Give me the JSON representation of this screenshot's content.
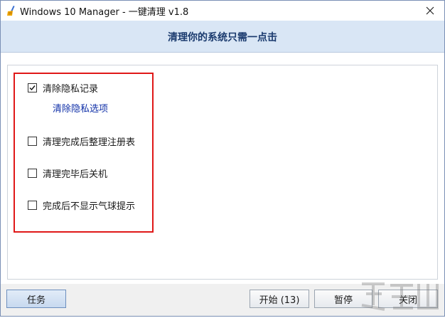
{
  "window": {
    "title": "Windows 10 Manager - 一键清理 v1.8"
  },
  "header": {
    "title": "清理你的系统只需一点击"
  },
  "options": [
    {
      "label": "清除隐私记录",
      "checked": true
    },
    {
      "label": "清理完成后整理注册表",
      "checked": false
    },
    {
      "label": "清理完毕后关机",
      "checked": false
    },
    {
      "label": "完成后不显示气球提示",
      "checked": false
    }
  ],
  "privacy_link": "清除隐私选项",
  "buttons": {
    "tasks": "任务",
    "start": "开始 (13)",
    "pause": "暂停",
    "close": "关闭"
  },
  "colors": {
    "highlight_box": "#e01818",
    "header_band": "#d9e6f5",
    "link": "#1030a8"
  }
}
